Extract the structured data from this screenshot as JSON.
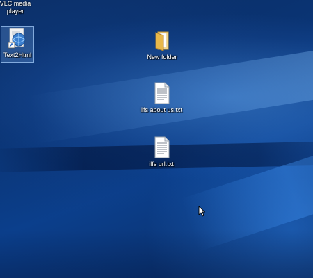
{
  "desktop": {
    "icons": [
      {
        "label": "VLC media player",
        "icon": "vlc-icon"
      },
      {
        "label": "Text2Html",
        "icon": "text2html-app-icon",
        "selected": true
      },
      {
        "label": "New folder",
        "icon": "folder-icon"
      },
      {
        "label": "ilfs about us.txt",
        "icon": "text-file-icon"
      },
      {
        "label": "ilfs url.txt",
        "icon": "text-file-icon"
      }
    ],
    "colors": {
      "background": "#0a3474",
      "label_text": "#ffffff",
      "folder": "#e8b84a"
    }
  }
}
